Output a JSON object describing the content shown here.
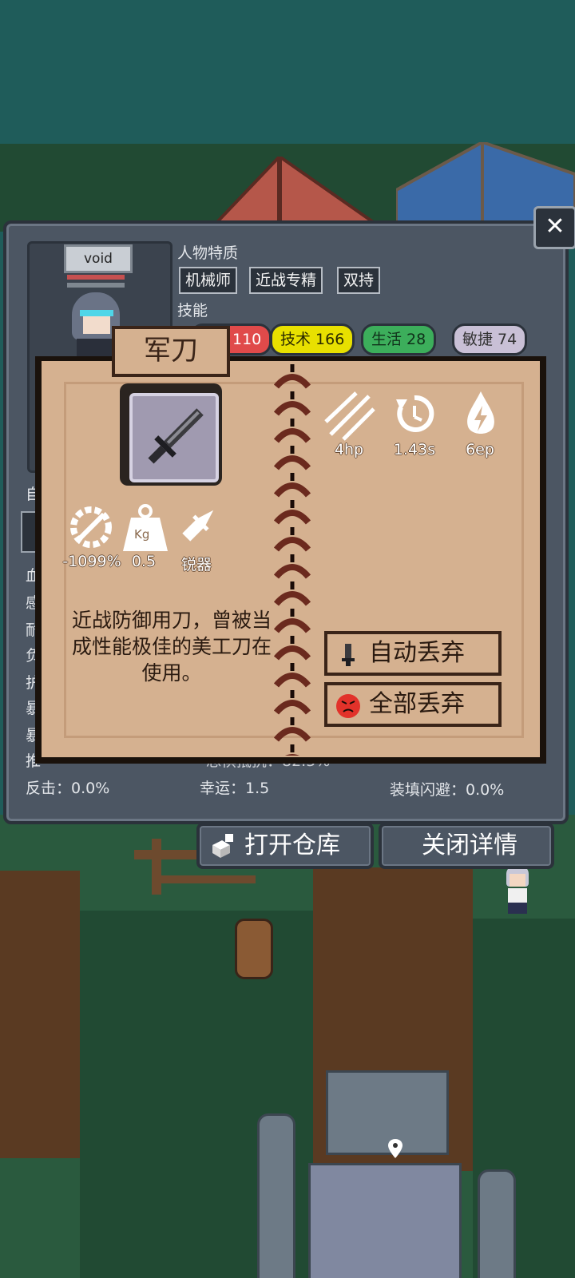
{
  "character": {
    "name": "void",
    "traits_label": "人物特质",
    "traits": [
      "机械师",
      "近战专精",
      "双持"
    ],
    "skills_label": "技能",
    "skills": [
      {
        "label": "110",
        "color": "#e04a4a"
      },
      {
        "label": "技术 166",
        "color": "#e8e000"
      },
      {
        "label": "生活 28",
        "color": "#3cae5b"
      },
      {
        "label": "敏捷 74",
        "color": "#c9c0d6"
      }
    ],
    "side_label": "自",
    "stat_initials": [
      "血",
      "感",
      "耐",
      "负",
      "护",
      "暴",
      "暴",
      "推"
    ],
    "bottom_stats": {
      "counter": "反击：0.0%",
      "luck": "幸运：1.5",
      "reload_dodge": "装填闪避：0.0%",
      "partial_left": "推",
      "partial_mid": "恐惧抵抗：82.5%"
    },
    "close_label": "✕"
  },
  "item": {
    "name": "军刀",
    "attack_cost": "4hp",
    "cooldown": "1.43s",
    "energy": "6ep",
    "repair": "-1099%",
    "weight": "0.5",
    "weight_unit": "Kg",
    "type": "锐器",
    "description": "近战防御用刀，曾被当成性能极佳的美工刀在使用。",
    "auto_discard_label": "自动丢弃",
    "discard_all_label": "全部丢弃"
  },
  "buttons": {
    "open_storage": "打开仓库",
    "close_detail": "关闭详情"
  }
}
